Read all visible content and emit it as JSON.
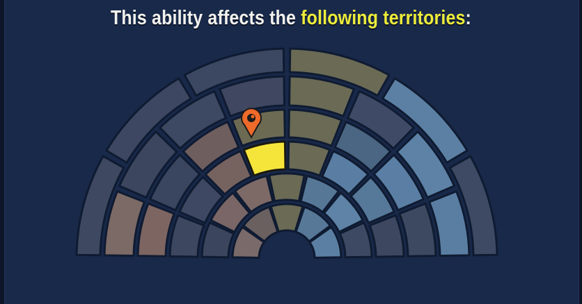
{
  "title": {
    "text_before": "This ability affects the",
    "text_highlight": "following territories",
    "text_after": ":"
  },
  "colors": {
    "background": "#19294a",
    "highlight_text": "#ecec3a",
    "selected_territory": "#f5e53a",
    "location_pin": "#ee6a2a"
  },
  "map": {
    "pin_icon": "location-pin-icon",
    "selected_territory": "territory-r3-s4",
    "rings": [
      {
        "ring": 1,
        "sectors": 5,
        "colors": [
          "#7a6a6a",
          "#6a6060",
          "#6a6a55",
          "#587898",
          "#5a7fa3"
        ]
      },
      {
        "ring": 2,
        "sectors": 7,
        "colors": [
          "#3b465e",
          "#7a6666",
          "#7d6a67",
          "#6a6a55",
          "#577797",
          "#5e83a6",
          "#3d4963"
        ]
      },
      {
        "ring": 3,
        "sectors": 8,
        "colors": [
          "#3d4860",
          "#3e4862",
          "#76625f",
          "#f5e53a",
          "#6a6a55",
          "#5a7ea3",
          "#577999",
          "#3d4860"
        ]
      },
      {
        "ring": 4,
        "sectors": 8,
        "colors": [
          "#7d6562",
          "#3a4560",
          "#6f5e5e",
          "#6c6a52",
          "#6a6a55",
          "#4a6682",
          "#5b7fa4",
          "#3d4961"
        ]
      },
      {
        "ring": 5,
        "sectors": 8,
        "colors": [
          "#7c6a66",
          "#3c465e",
          "#3d4862",
          "#404760",
          "#6a6a55",
          "#3f4b66",
          "#5d82a6",
          "#5a7ea2"
        ]
      },
      {
        "ring": 6,
        "sectors": 6,
        "colors": [
          "#3e4961",
          "#3d4762",
          "#3c4761",
          "#6a6a55",
          "#5c80a3",
          "#3e4a64"
        ]
      }
    ]
  }
}
